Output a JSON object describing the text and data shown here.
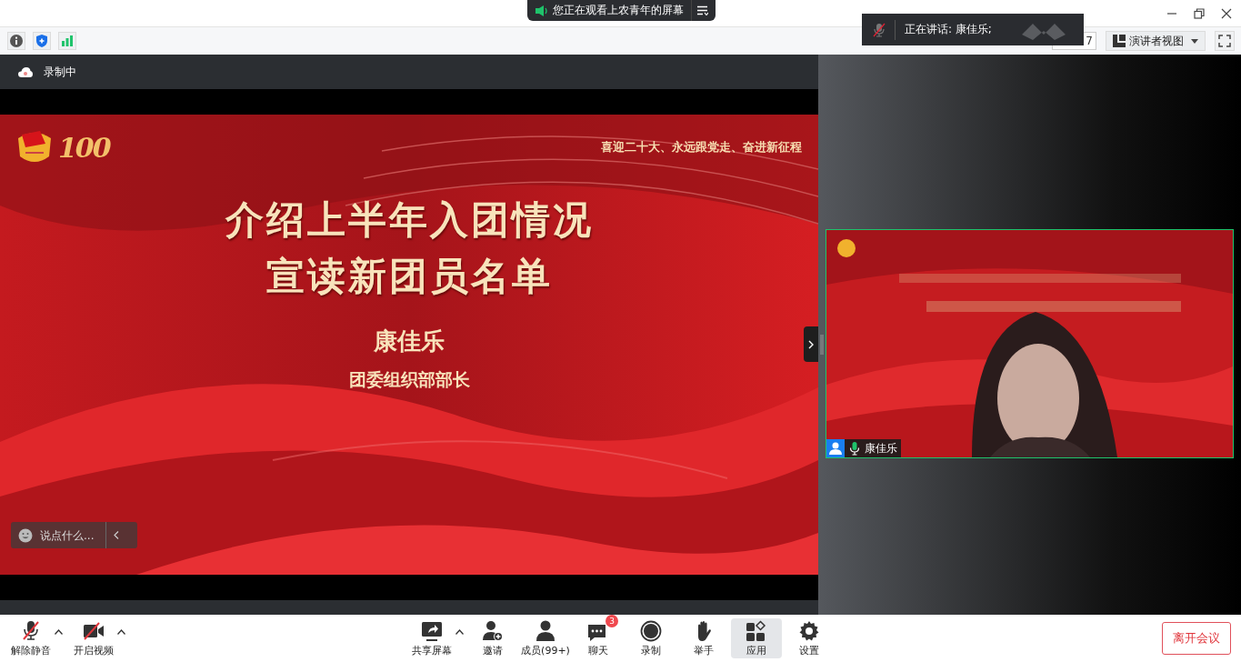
{
  "title_bar": {
    "share_notice": "您正在观看上农青年的屏幕"
  },
  "speaking_toast": {
    "text": "正在讲话: 康佳乐;"
  },
  "toolbar": {
    "page_field": "7",
    "view_button": "演讲者视图"
  },
  "recording": {
    "label": "录制中"
  },
  "slide": {
    "logo": "100",
    "slogan": "喜迎二十大、永远跟党走、奋进新征程",
    "title_lines": [
      "介绍上半年入团情况",
      "宣读新团员名单"
    ],
    "speaker": "康佳乐",
    "role": "团委组织部部长"
  },
  "chat_input": {
    "placeholder": "说点什么..."
  },
  "video_tile": {
    "kind": "picture",
    "name": "康佳乐"
  },
  "left_controls": [
    {
      "kind": "mic-off",
      "label": "解除静音",
      "has_menu": true,
      "selected": false
    },
    {
      "kind": "camera-off",
      "label": "开启视频",
      "has_menu": true,
      "selected": false
    }
  ],
  "center_controls": [
    {
      "kind": "share",
      "label": "共享屏幕",
      "has_menu": true,
      "selected": false
    },
    {
      "kind": "invite",
      "label": "邀请",
      "has_menu": false,
      "selected": false
    },
    {
      "kind": "members",
      "label": "成员(99+)",
      "has_menu": false,
      "selected": false
    },
    {
      "kind": "chat",
      "label": "聊天",
      "badge": "3",
      "has_menu": false,
      "selected": false
    },
    {
      "kind": "record",
      "label": "录制",
      "has_menu": false,
      "selected": false
    },
    {
      "kind": "hand",
      "label": "举手",
      "has_menu": false,
      "selected": false
    },
    {
      "kind": "apps",
      "label": "应用",
      "has_menu": false,
      "selected": true
    },
    {
      "kind": "settings",
      "label": "设置",
      "has_menu": false,
      "selected": false
    }
  ],
  "leave_button": "离开会议"
}
